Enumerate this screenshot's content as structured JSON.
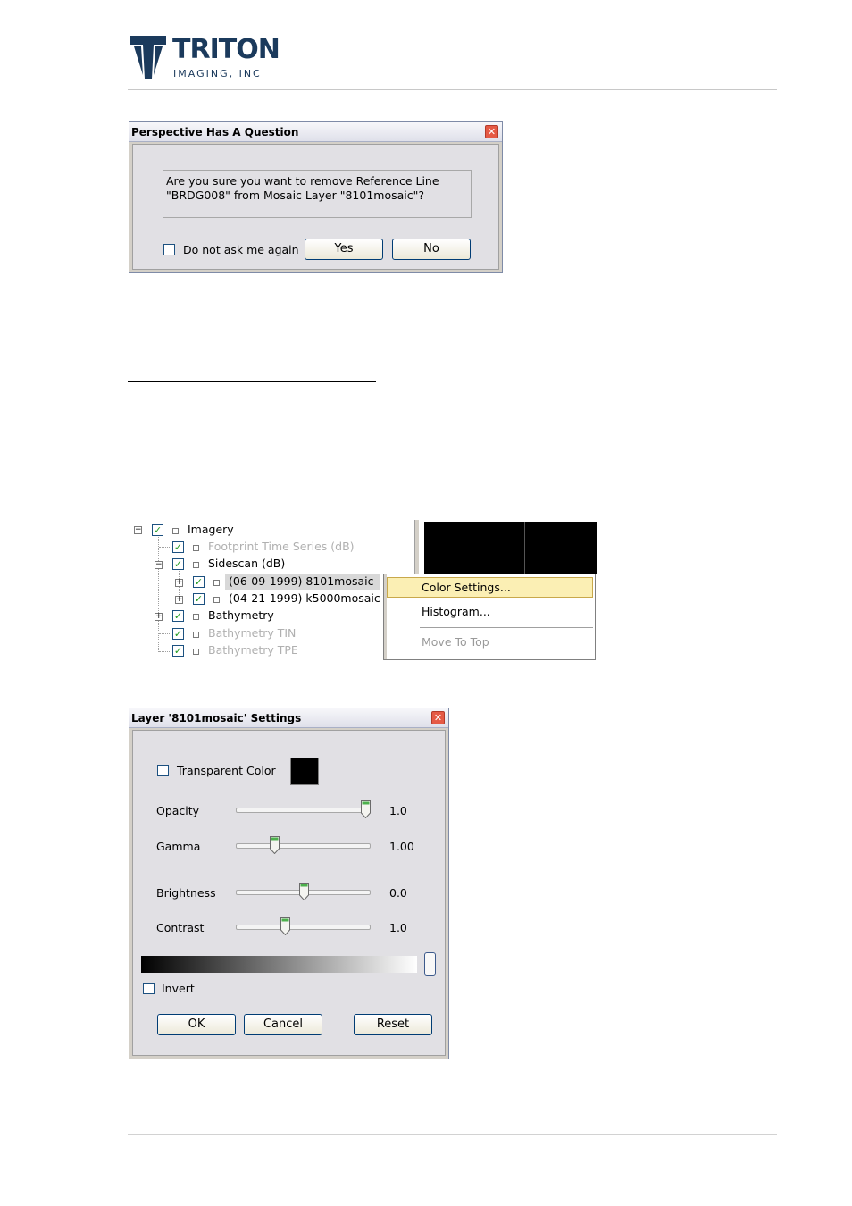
{
  "logo": {
    "name": "TRITON",
    "sub": "IMAGING, INC"
  },
  "dialog1": {
    "title": "Perspective Has A Question",
    "message_line1": "Are you sure you want to remove Reference Line",
    "message_line2": "\"BRDG008\" from Mosaic Layer \"8101mosaic\"?",
    "checkbox_label": "Do not ask me again",
    "yes": "Yes",
    "no": "No"
  },
  "tree": {
    "items": [
      {
        "label": "Imagery"
      },
      {
        "label": "Footprint Time Series (dB)"
      },
      {
        "label": "Sidescan (dB)"
      },
      {
        "label": "(06-09-1999) 8101mosaic"
      },
      {
        "label": "(04-21-1999) k5000mosaic"
      },
      {
        "label": "Bathymetry"
      },
      {
        "label": "Bathymetry TIN"
      },
      {
        "label": "Bathymetry TPE"
      }
    ]
  },
  "context_menu": {
    "items": [
      "Color Settings...",
      "Histogram...",
      "Move To Top"
    ]
  },
  "dialog2": {
    "title": "Layer '8101mosaic' Settings",
    "transparent_label": "Transparent Color",
    "transparent_color": "#000000",
    "sliders": [
      {
        "label": "Opacity",
        "value": "1.0",
        "position": 1.0
      },
      {
        "label": "Gamma",
        "value": "1.00",
        "position": 0.26
      },
      {
        "label": "Brightness",
        "value": "0.0",
        "position": 0.5
      },
      {
        "label": "Contrast",
        "value": "1.0",
        "position": 0.35
      }
    ],
    "invert_label": "Invert",
    "ok": "OK",
    "cancel": "Cancel",
    "reset": "Reset"
  }
}
